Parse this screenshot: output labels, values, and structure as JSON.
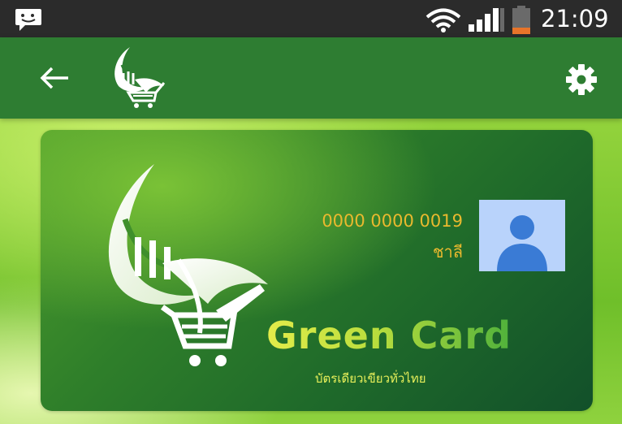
{
  "status_bar": {
    "time": "21:09",
    "icons": [
      "message-icon",
      "wifi-icon",
      "signal-icon",
      "battery-icon"
    ]
  },
  "app_bar": {
    "icons": [
      "back-arrow-icon",
      "green-leaf-cart-logo",
      "gear-icon"
    ]
  },
  "card": {
    "number": "0000 0000 0019",
    "holder_name": "ชาลี",
    "brand_name": "Green Card",
    "tagline": "บัตรเดียวเขียวทั่วไทย",
    "avatar_icon": "person-icon"
  },
  "colors": {
    "status_bar_bg": "#2b2b2b",
    "app_bar_bg": "#2e7d32",
    "card_text_gold": "#e9b92e",
    "avatar_bg": "#b9d3fb",
    "avatar_figure": "#3a7bd5",
    "battery_level": "#e8742a"
  }
}
